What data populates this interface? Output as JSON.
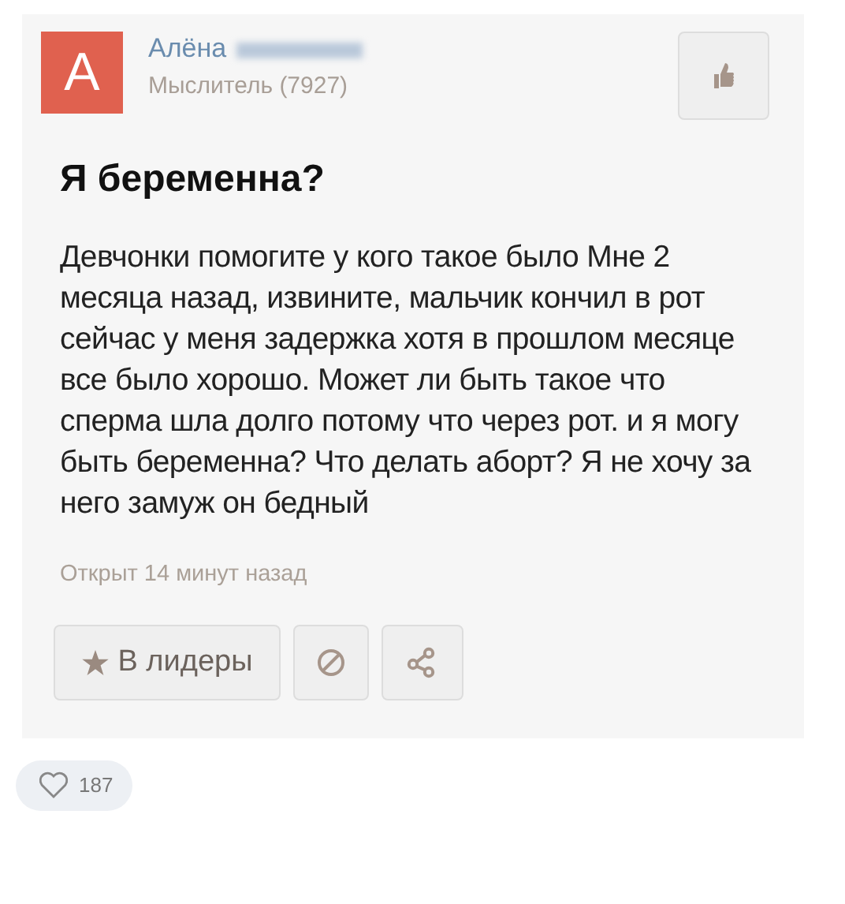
{
  "author": {
    "avatar_letter": "A",
    "name": "Алёна",
    "rank": "Мыслитель (7927)"
  },
  "question": {
    "title": "Я беременна?",
    "body": "Девчонки помогите у кого такое было Мне 2 месяца назад, извините, мальчик кончил в рот сейчас у меня задержка хотя в прошлом месяце все было хорошо. Может ли быть такое что сперма шла долго потому что через рот. и я могу быть беременна? Что делать аборт? Я не хочу за него замуж он бедный",
    "opened": "Открыт 14 минут назад"
  },
  "actions": [
    {
      "kind": "leaders",
      "label": "В лидеры"
    },
    {
      "kind": "block"
    },
    {
      "kind": "share"
    }
  ],
  "likes": {
    "count": "187"
  }
}
